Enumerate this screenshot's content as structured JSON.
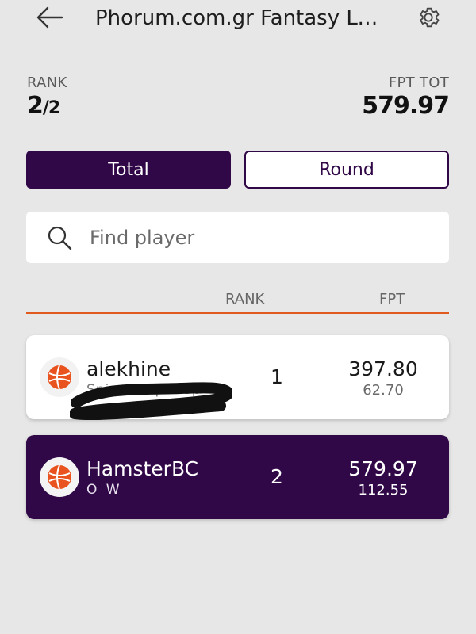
{
  "header": {
    "title": "Phorum.com.gr Fantasy Le...",
    "back_icon": "back-arrow-icon",
    "settings_icon": "gear-icon"
  },
  "summary": {
    "rank_label": "RANK",
    "rank_num": "2",
    "rank_den": "/2",
    "fpt_label": "FPT TOT",
    "fpt_value": "579.97"
  },
  "tabs": {
    "total_label": "Total",
    "round_label": "Round",
    "selected": "Total"
  },
  "search": {
    "placeholder": "Find player",
    "value": ""
  },
  "table": {
    "col_rank": "RANK",
    "col_fpt": "FPT",
    "rows": [
      {
        "name": "alekhine",
        "subtitle": "Spiros Papadop",
        "rank": "1",
        "fpt": "397.80",
        "round": "62.70",
        "highlighted": false
      },
      {
        "name": "HamsterBC",
        "subtitle": "O W",
        "rank": "2",
        "fpt": "579.97",
        "round": "112.55",
        "highlighted": true
      }
    ]
  },
  "colors": {
    "accent": "#300747",
    "divider": "#e05a1e",
    "logo": "#e8531f",
    "background": "#e7e7e7"
  }
}
